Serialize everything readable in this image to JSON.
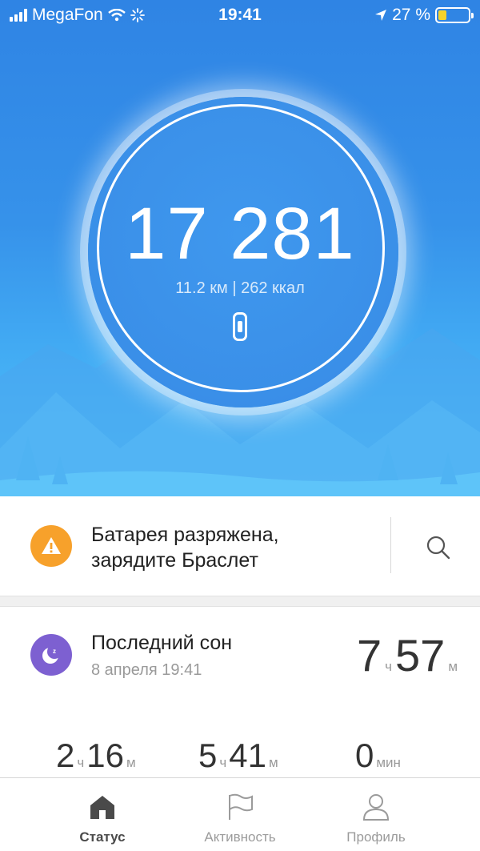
{
  "status_bar": {
    "carrier": "MegaFon",
    "time": "19:41",
    "battery_percent": "27 %",
    "battery_level": 0.27
  },
  "hero": {
    "steps": "17 281",
    "distance": "11.2 км",
    "calories": "262 ккал",
    "separator": "|"
  },
  "alert": {
    "line1": "Батарея разряжена,",
    "line2": "зарядите Браслет",
    "icon": "warning-icon"
  },
  "sleep": {
    "title": "Последний сон",
    "date": "8 апреля 19:41",
    "total_hours": "7",
    "total_hours_unit": "ч",
    "total_minutes": "57",
    "total_minutes_unit": "м",
    "stats": [
      {
        "hours": "2",
        "hours_unit": "ч",
        "minutes": "16",
        "minutes_unit": "м"
      },
      {
        "hours": "5",
        "hours_unit": "ч",
        "minutes": "41",
        "minutes_unit": "м"
      },
      {
        "value": "0",
        "unit": "мин"
      }
    ]
  },
  "tabs": [
    {
      "label": "Статус",
      "icon": "home-icon",
      "active": true
    },
    {
      "label": "Активность",
      "icon": "flag-icon",
      "active": false
    },
    {
      "label": "Профиль",
      "icon": "profile-icon",
      "active": false
    }
  ],
  "colors": {
    "hero_top": "#2f84e4",
    "hero_bottom": "#52c0f7",
    "warning": "#f7a12b",
    "sleep": "#7d60d1",
    "battery_fill": "#f7d229"
  }
}
